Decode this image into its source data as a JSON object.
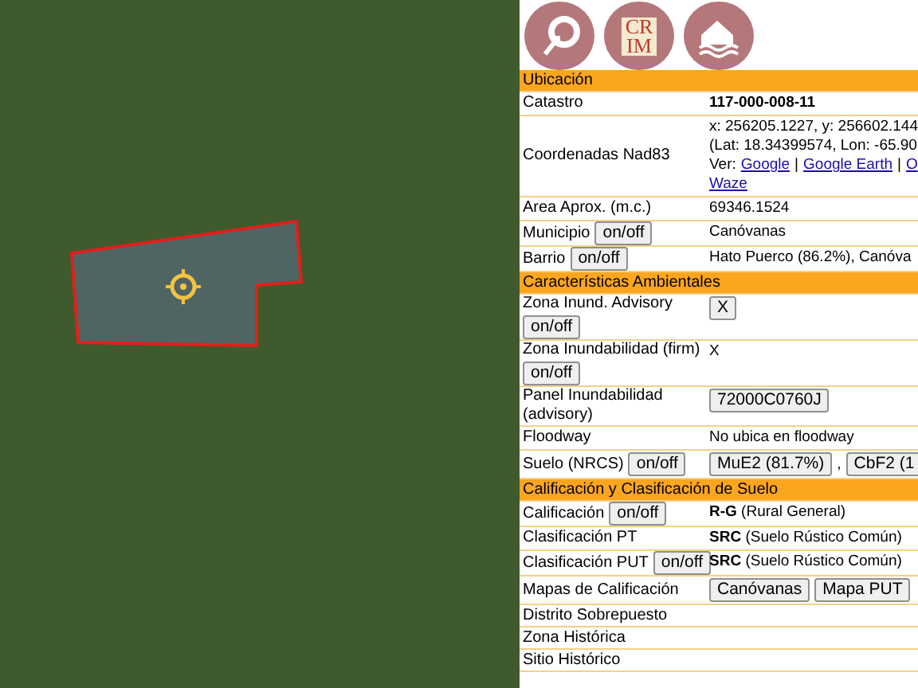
{
  "toolbar": {
    "logo_lines": [
      "CR",
      "IM"
    ]
  },
  "sections": [
    {
      "title": "Ubicación",
      "rows": [
        {
          "label": "Catastro",
          "lines": [
            [
              {
                "kind": "bold",
                "text": "117-000-008-11"
              }
            ]
          ]
        },
        {
          "label": "Coordenadas Nad83",
          "lines": [
            [
              {
                "kind": "text",
                "text": "x: 256205.1227, y: 256602.144"
              }
            ],
            [
              {
                "kind": "text",
                "text": "(Lat: 18.34399574, Lon: -65.90"
              }
            ],
            [
              {
                "kind": "text",
                "text": "Ver:"
              },
              {
                "kind": "link",
                "text": "Google"
              },
              {
                "kind": "text",
                "text": "|"
              },
              {
                "kind": "link",
                "text": "Google Earth"
              },
              {
                "kind": "text",
                "text": "|"
              },
              {
                "kind": "link",
                "text": "O"
              }
            ],
            [
              {
                "kind": "link",
                "text": "Waze"
              }
            ]
          ]
        },
        {
          "label": "Area Aprox. (m.c.)",
          "lines": [
            [
              {
                "kind": "text",
                "text": "69346.1524"
              }
            ]
          ]
        },
        {
          "label": "Municipio",
          "toggle": "on/off",
          "toggle_below": false,
          "lines": [
            [
              {
                "kind": "text",
                "text": "Canóvanas"
              }
            ]
          ]
        },
        {
          "label": "Barrio",
          "toggle": "on/off",
          "toggle_below": false,
          "lines": [
            [
              {
                "kind": "text",
                "text": "Hato Puerco (86.2%), Canóva"
              }
            ]
          ]
        }
      ]
    },
    {
      "title": "Características Ambientales",
      "rows": [
        {
          "label": "Zona Inund. Advisory",
          "toggle": "on/off",
          "toggle_below": true,
          "lines": [
            [
              {
                "kind": "button",
                "text": "X"
              }
            ]
          ]
        },
        {
          "label": "Zona Inundabilidad (firm)",
          "toggle": "on/off",
          "toggle_below": true,
          "lines": [
            [
              {
                "kind": "text",
                "text": "X"
              }
            ]
          ]
        },
        {
          "label": "Panel Inundabilidad (advisory)",
          "lines": [
            [
              {
                "kind": "button",
                "text": "72000C0760J"
              }
            ]
          ]
        },
        {
          "label": "Floodway",
          "lines": [
            [
              {
                "kind": "text",
                "text": "No ubica en floodway"
              }
            ]
          ]
        },
        {
          "label": "Suelo (NRCS)",
          "toggle": "on/off",
          "toggle_below": false,
          "lines": [
            [
              {
                "kind": "button",
                "text": "MuE2 (81.7%)"
              },
              {
                "kind": "text",
                "text": ","
              },
              {
                "kind": "button",
                "text": "CbF2 (1"
              }
            ]
          ]
        }
      ]
    },
    {
      "title": "Calificación y Clasificación de Suelo",
      "rows": [
        {
          "label": "Calificación",
          "toggle": "on/off",
          "toggle_below": false,
          "lines": [
            [
              {
                "kind": "rich",
                "text": "**R-G** (Rural General)"
              }
            ]
          ]
        },
        {
          "label": "Clasificación PT",
          "lines": [
            [
              {
                "kind": "rich",
                "text": "**SRC** (Suelo Rústico Común)"
              }
            ]
          ]
        },
        {
          "label": "Clasificación PUT",
          "toggle": "on/off",
          "toggle_below": false,
          "lines": [
            [
              {
                "kind": "rich",
                "text": "**SRC** (Suelo Rústico Común)"
              }
            ]
          ]
        },
        {
          "label": "Mapas de Calificación",
          "lines": [
            [
              {
                "kind": "button",
                "text": "Canóvanas"
              },
              {
                "kind": "button",
                "text": "Mapa PUT"
              }
            ]
          ]
        },
        {
          "label": "Distrito Sobrepuesto",
          "lines": []
        },
        {
          "label": "Zona Histórica",
          "lines": []
        },
        {
          "label": "Sitio Histórico",
          "lines": []
        }
      ]
    }
  ]
}
